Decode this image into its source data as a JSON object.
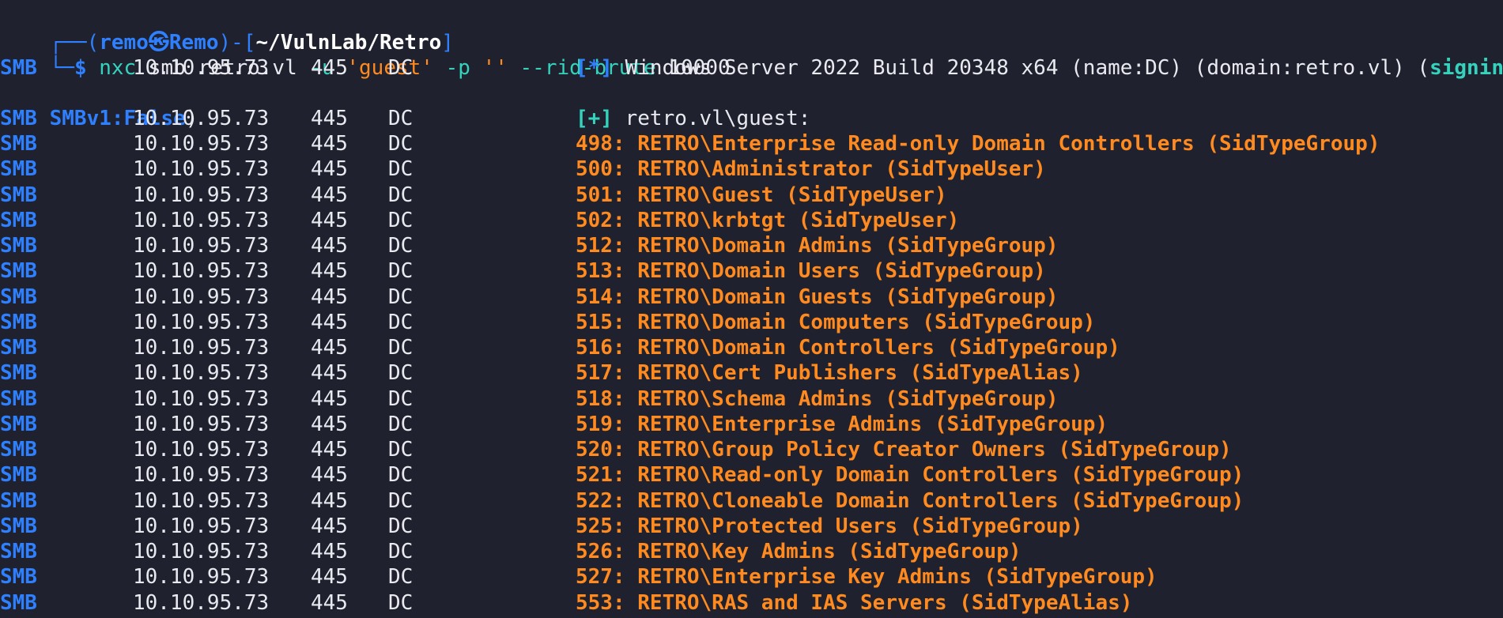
{
  "prompt": {
    "corner_top": "┌──",
    "corner_bottom": "└─",
    "user": "remo",
    "at_symbol": "㉿",
    "host": "Remo",
    "path": "~/VulnLab/Retro",
    "symbol": "$"
  },
  "command": {
    "tool": "nxc",
    "proto": "smb",
    "target": "retro.vl",
    "user_flag": "-u",
    "user_value": "'guest'",
    "pass_flag": "-p",
    "pass_value": "''",
    "rid_flag": "--rid-brute",
    "rid_value": "10000"
  },
  "info_line": {
    "proto": "SMB",
    "ip": "10.10.95.73",
    "port": "445",
    "host": "DC",
    "marker": "[*]",
    "text": "Windows Server 2022 Build 20348 x64 (name:DC) (domain:retro.vl) (",
    "signing": "signing:True",
    "tail": ") (",
    "wrap_key": "SMBv1:False",
    "wrap_tail": ")"
  },
  "auth_line": {
    "proto": "SMB",
    "ip": "10.10.95.73",
    "port": "445",
    "host": "DC",
    "marker": "[+]",
    "text": "retro.vl\\guest:"
  },
  "rid_rows": [
    {
      "proto": "SMB",
      "ip": "10.10.95.73",
      "port": "445",
      "host": "DC",
      "entry": "498: RETRO\\Enterprise Read-only Domain Controllers (SidTypeGroup)"
    },
    {
      "proto": "SMB",
      "ip": "10.10.95.73",
      "port": "445",
      "host": "DC",
      "entry": "500: RETRO\\Administrator (SidTypeUser)"
    },
    {
      "proto": "SMB",
      "ip": "10.10.95.73",
      "port": "445",
      "host": "DC",
      "entry": "501: RETRO\\Guest (SidTypeUser)"
    },
    {
      "proto": "SMB",
      "ip": "10.10.95.73",
      "port": "445",
      "host": "DC",
      "entry": "502: RETRO\\krbtgt (SidTypeUser)"
    },
    {
      "proto": "SMB",
      "ip": "10.10.95.73",
      "port": "445",
      "host": "DC",
      "entry": "512: RETRO\\Domain Admins (SidTypeGroup)"
    },
    {
      "proto": "SMB",
      "ip": "10.10.95.73",
      "port": "445",
      "host": "DC",
      "entry": "513: RETRO\\Domain Users (SidTypeGroup)"
    },
    {
      "proto": "SMB",
      "ip": "10.10.95.73",
      "port": "445",
      "host": "DC",
      "entry": "514: RETRO\\Domain Guests (SidTypeGroup)"
    },
    {
      "proto": "SMB",
      "ip": "10.10.95.73",
      "port": "445",
      "host": "DC",
      "entry": "515: RETRO\\Domain Computers (SidTypeGroup)"
    },
    {
      "proto": "SMB",
      "ip": "10.10.95.73",
      "port": "445",
      "host": "DC",
      "entry": "516: RETRO\\Domain Controllers (SidTypeGroup)"
    },
    {
      "proto": "SMB",
      "ip": "10.10.95.73",
      "port": "445",
      "host": "DC",
      "entry": "517: RETRO\\Cert Publishers (SidTypeAlias)"
    },
    {
      "proto": "SMB",
      "ip": "10.10.95.73",
      "port": "445",
      "host": "DC",
      "entry": "518: RETRO\\Schema Admins (SidTypeGroup)"
    },
    {
      "proto": "SMB",
      "ip": "10.10.95.73",
      "port": "445",
      "host": "DC",
      "entry": "519: RETRO\\Enterprise Admins (SidTypeGroup)"
    },
    {
      "proto": "SMB",
      "ip": "10.10.95.73",
      "port": "445",
      "host": "DC",
      "entry": "520: RETRO\\Group Policy Creator Owners (SidTypeGroup)"
    },
    {
      "proto": "SMB",
      "ip": "10.10.95.73",
      "port": "445",
      "host": "DC",
      "entry": "521: RETRO\\Read-only Domain Controllers (SidTypeGroup)"
    },
    {
      "proto": "SMB",
      "ip": "10.10.95.73",
      "port": "445",
      "host": "DC",
      "entry": "522: RETRO\\Cloneable Domain Controllers (SidTypeGroup)"
    },
    {
      "proto": "SMB",
      "ip": "10.10.95.73",
      "port": "445",
      "host": "DC",
      "entry": "525: RETRO\\Protected Users (SidTypeGroup)"
    },
    {
      "proto": "SMB",
      "ip": "10.10.95.73",
      "port": "445",
      "host": "DC",
      "entry": "526: RETRO\\Key Admins (SidTypeGroup)"
    },
    {
      "proto": "SMB",
      "ip": "10.10.95.73",
      "port": "445",
      "host": "DC",
      "entry": "527: RETRO\\Enterprise Key Admins (SidTypeGroup)"
    },
    {
      "proto": "SMB",
      "ip": "10.10.95.73",
      "port": "445",
      "host": "DC",
      "entry": "553: RETRO\\RAS and IAS Servers (SidTypeAlias)"
    }
  ],
  "colors": {
    "background": "#1f222e",
    "proto": "#2f80ff",
    "accent": "#35d3bd",
    "entry": "#ff8a1f",
    "text": "#e9e9f0"
  }
}
